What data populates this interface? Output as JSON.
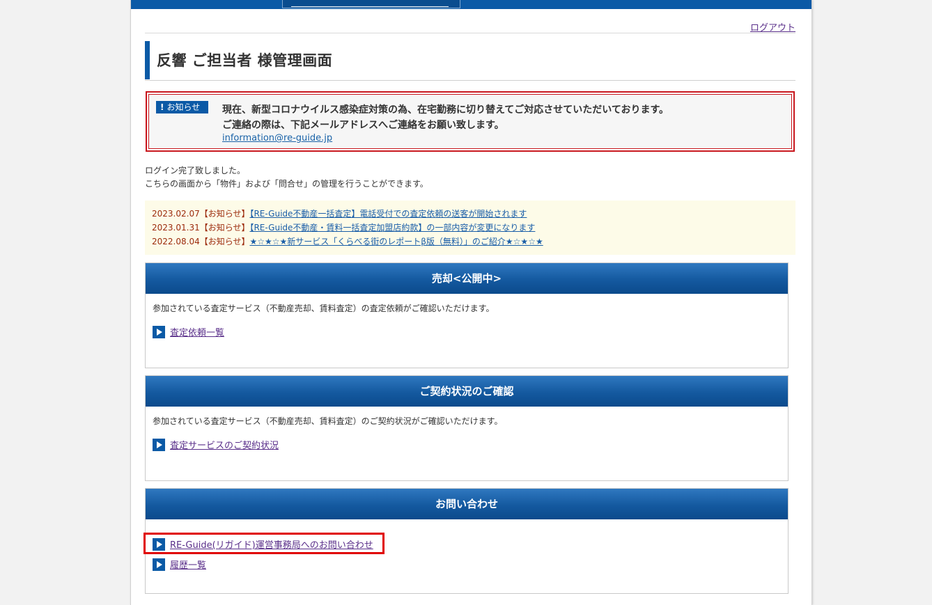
{
  "header": {
    "logout": "ログアウト"
  },
  "title": "反響 ご担当者 様管理画面",
  "notice": {
    "badge_icon": "!",
    "badge_label": "お知らせ",
    "line1": "現在、新型コロナウイルス感染症対策の為、在宅勤務に切り替えてご対応させていただいております。",
    "line2": "ご連絡の際は、下記メールアドレスへご連絡をお願い致します。",
    "email": "information@re-guide.jp"
  },
  "intro": {
    "line1": "ログイン完了致しました。",
    "line2": "こちらの画面から「物件」および「問合せ」の管理を行うことができます。"
  },
  "news": [
    {
      "date": "2023.02.07【お知らせ】",
      "link": "【RE-Guide不動産一括査定】電話受付での査定依頼の送客が開始されます"
    },
    {
      "date": "2023.01.31【お知らせ】",
      "link": "【RE-Guide不動産・賃料一括査定加盟店約款】の一部内容が変更になります"
    },
    {
      "date": "2022.08.04【お知らせ】",
      "link": "★☆★☆★新サービス「くらべる街のレポートβ版（無料）」のご紹介★☆★☆★"
    }
  ],
  "panels": {
    "sale": {
      "title": "売却<公開中>",
      "desc": "参加されている査定サービス（不動産売却、賃料査定）の査定依頼がご確認いただけます。",
      "link": "査定依頼一覧"
    },
    "contract": {
      "title": "ご契約状況のご確認",
      "desc": "参加されている査定サービス（不動産売却、賃料査定）のご契約状況がご確認いただけます。",
      "link": "査定サービスのご契約状況"
    },
    "contact": {
      "title": "お問い合わせ",
      "link1": "RE-Guide(リガイド)運営事務局へのお問い合わせ",
      "link2": "履歴一覧"
    }
  },
  "colors": {
    "brand_blue": "#0b5aa6",
    "alert_red": "#c8161d",
    "highlight_red": "#e00000"
  }
}
